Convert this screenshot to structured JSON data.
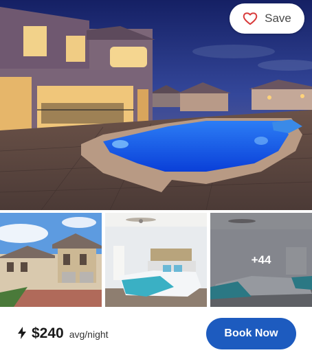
{
  "listing": {
    "save_label": "Save",
    "save_icon": "heart-outline-icon",
    "more_photos": "+44",
    "price": "$240",
    "price_unit": "avg/night",
    "price_icon": "lightning-bolt-icon",
    "book_label": "Book Now"
  },
  "colors": {
    "accent": "#1d5bbf",
    "heart": "#d83a3a"
  }
}
